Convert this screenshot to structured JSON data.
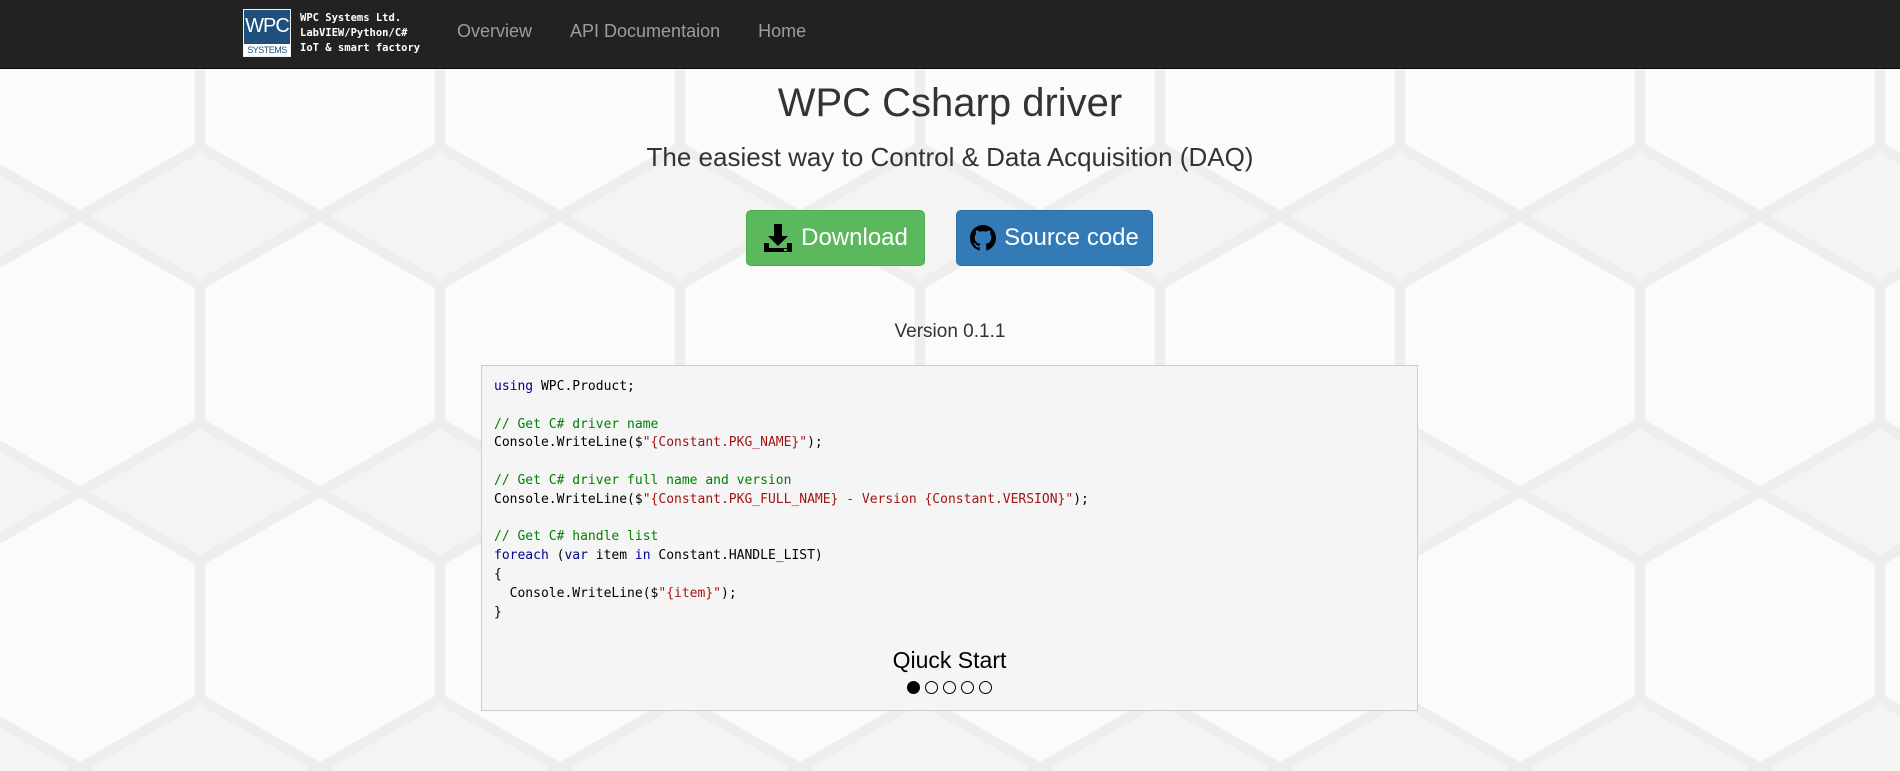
{
  "brand": {
    "logo_top": "WPC",
    "logo_bottom": "SYSTEMS",
    "lines": [
      "WPC Systems Ltd.",
      "LabVIEW/Python/C#",
      "IoT & smart factory"
    ]
  },
  "nav": {
    "items": [
      {
        "label": "Overview"
      },
      {
        "label": "API Documentaion"
      },
      {
        "label": "Home"
      }
    ]
  },
  "hero": {
    "title": "WPC Csharp driver",
    "subtitle": "The easiest way to Control & Data Acquisition (DAQ)",
    "download_label": "Download",
    "source_label": "Source code",
    "version": "Version 0.1.1"
  },
  "carousel": {
    "code": [
      {
        "kw1": "using",
        "rest": " WPC.Product;"
      },
      {
        "comment": "// Get C# driver name"
      },
      {
        "pre": "Console.WriteLine($",
        "str": "\"{Constant.PKG_NAME}\"",
        "post": ");"
      },
      {
        "comment": "// Get C# driver full name and version"
      },
      {
        "pre": "Console.WriteLine($",
        "str": "\"{Constant.PKG_FULL_NAME} - Version {Constant.VERSION}\"",
        "post": ");"
      },
      {
        "comment": "// Get C# handle list"
      },
      {
        "kw1": "foreach",
        "a": " (",
        "kw2": "var",
        "b": " item ",
        "kw3": "in",
        "c": " Constant.HANDLE_LIST)"
      },
      {
        "brace_open": "{"
      },
      {
        "pre": "  Console.WriteLine($",
        "str": "\"{item}\"",
        "post": ");"
      },
      {
        "brace_close": "}"
      }
    ],
    "caption": "Qiuck Start",
    "slide_count": 5,
    "active_slide": 1
  },
  "colors": {
    "navbar": "#222222",
    "download_button": "#5cb85c",
    "source_button": "#337ab7",
    "keyword": "#00008b",
    "comment": "#008000",
    "string": "#a31515"
  }
}
